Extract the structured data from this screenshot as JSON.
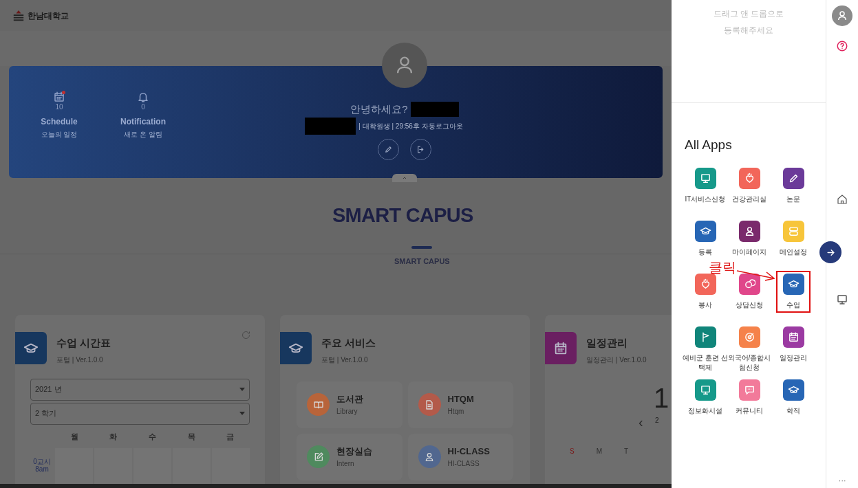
{
  "header": {
    "logo_text": "한남대학교"
  },
  "profile": {
    "stats": [
      {
        "kind": "calendar",
        "count": "10",
        "label": "Schedule",
        "sub": "오늘의 일정",
        "alert": true
      },
      {
        "kind": "bell",
        "count": "0",
        "label": "Notification",
        "sub": "새로 온 알림",
        "alert": false
      }
    ],
    "greeting": "안녕하세요?",
    "role": "| 대학원생 | 29:56후 자동로그아웃"
  },
  "section": {
    "title": "SMART CAPUS",
    "tab": "SMART CAPUS"
  },
  "cards": [
    {
      "kind": "timetable",
      "color": "#17375e",
      "title": "수업 시간표",
      "meta": "포털 | Ver.1.0.0",
      "year": "2021 년",
      "term": "2 학기",
      "days": [
        "월",
        "화",
        "수",
        "목",
        "금"
      ],
      "period": "0교시",
      "time": "8am"
    },
    {
      "kind": "services",
      "color": "#17375e",
      "title": "주요 서비스",
      "meta": "포털 | Ver.1.0.0",
      "services": [
        {
          "kind": "book",
          "color": "#b8643a",
          "name": "도서관",
          "sub": "Library"
        },
        {
          "kind": "doc",
          "color": "#b35a4a",
          "name": "HTQM",
          "sub": "Htqm"
        },
        {
          "kind": "edit",
          "color": "#4f8a5e",
          "name": "현장실습",
          "sub": "Intern"
        },
        {
          "kind": "person",
          "color": "#51678f",
          "name": "HI-CLASS",
          "sub": "HI-CLASS"
        }
      ]
    },
    {
      "kind": "calendar",
      "color": "#6a1f61",
      "title": "일정관리",
      "meta": "일정관리 | Ver.1.0.0",
      "big": "1",
      "year": "2",
      "prev": "‹",
      "weekdays": [
        "S",
        "M",
        "T"
      ]
    }
  ],
  "panel": {
    "drop_hint": "드래그 앤 드롭으로\n등록해주세요",
    "title": "All Apps",
    "apps": [
      {
        "kind": "monitor",
        "color": "#16998a",
        "label": "IT서비스신청",
        "highlighted": false
      },
      {
        "kind": "heart",
        "color": "#f2665a",
        "label": "건강관리실",
        "highlighted": false
      },
      {
        "kind": "pencil",
        "color": "#6b3a99",
        "label": "논문",
        "highlighted": false
      },
      {
        "kind": "cap",
        "color": "#2766b5",
        "label": "등록",
        "highlighted": false
      },
      {
        "kind": "person",
        "color": "#7a2a6c",
        "label": "마이페이지",
        "highlighted": false
      },
      {
        "kind": "grid",
        "color": "#f7c53a",
        "label": "메인설정",
        "highlighted": false
      },
      {
        "kind": "heart",
        "color": "#f2665a",
        "label": "봉사",
        "highlighted": false
      },
      {
        "kind": "chat",
        "color": "#e0468a",
        "label": "상담신청",
        "highlighted": false
      },
      {
        "kind": "cap",
        "color": "#2766b5",
        "label": "수업",
        "highlighted": true
      },
      {
        "kind": "flag",
        "color": "#10857a",
        "label": "예비군 훈련 선택제",
        "highlighted": false
      },
      {
        "kind": "target",
        "color": "#f5824a",
        "label": "외국어/종합시험신청",
        "highlighted": false
      },
      {
        "kind": "calendar",
        "color": "#9b3aa2",
        "label": "일정관리",
        "highlighted": false
      },
      {
        "kind": "monitor",
        "color": "#16998a",
        "label": "정보화시설",
        "highlighted": false
      },
      {
        "kind": "message",
        "color": "#f27a9a",
        "label": "커뮤니티",
        "highlighted": false
      },
      {
        "kind": "cap",
        "color": "#2766b5",
        "label": "학적",
        "highlighted": false
      }
    ],
    "annotation": "클릭"
  },
  "rail": {
    "more": "···"
  }
}
